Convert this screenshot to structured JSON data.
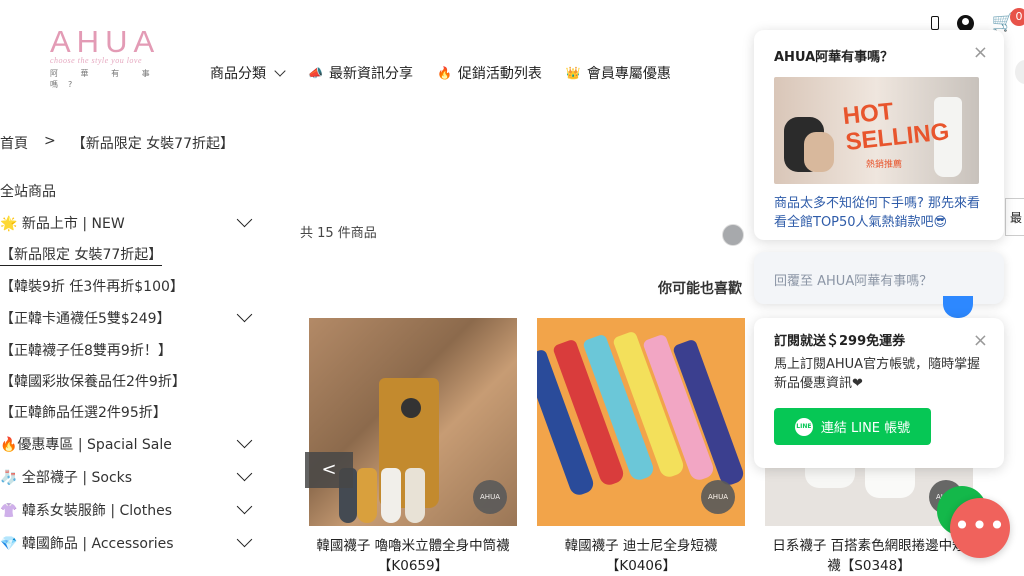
{
  "header": {
    "logo": {
      "main": "AHUA",
      "tagline": "choose the style you love",
      "zh": "阿 華 有 事 嗎?"
    },
    "nav": [
      {
        "label": "商品分類",
        "icon": "chevron-down-icon"
      },
      {
        "label": "最新資訊分享",
        "icon": "megaphone-icon"
      },
      {
        "label": "促銷活動列表",
        "icon": "fire-icon"
      },
      {
        "label": "會員專屬優惠",
        "icon": "crown-icon"
      }
    ],
    "cart_count": "0"
  },
  "breadcrumb": {
    "home": "首頁",
    "sep": ">",
    "current": "【新品限定 女裝77折起】"
  },
  "sidebar": {
    "title": "全站商品",
    "items": [
      {
        "label": "🌟 新品上市 | NEW",
        "expandable": true
      },
      {
        "label": "【新品限定 女裝77折起】",
        "expandable": false,
        "active": true
      },
      {
        "label": "【韓裝9折 任3件再折$100】",
        "expandable": false
      },
      {
        "label": "【正韓卡通襪任5雙$249】",
        "expandable": true
      },
      {
        "label": "【正韓襪子任8雙再9折！】",
        "expandable": false
      },
      {
        "label": "【韓國彩妝保養品任2件9折】",
        "expandable": false
      },
      {
        "label": "【正韓飾品任選2件95折】",
        "expandable": false
      },
      {
        "label": "🔥優惠專區 | Spacial Sale",
        "expandable": true
      },
      {
        "label": "🧦 全部襪子 | Socks",
        "expandable": true
      },
      {
        "label": "👚 韓系女裝服飾 | Clothes",
        "expandable": true
      },
      {
        "label": "💎 韓國飾品 | Accessories",
        "expandable": true
      }
    ]
  },
  "main": {
    "count_text": "共 15 件商品",
    "maybe_like": "你可能也喜歡",
    "products": [
      {
        "name": "韓國襪子 嚕嚕米立體全身中筒襪",
        "code": "【K0659】",
        "brand": "AHUA"
      },
      {
        "name": "韓國襪子 迪士尼全身短襪",
        "code": "【K0406】",
        "brand": "AHUA"
      },
      {
        "name": "日系襪子 百搭素色網眼捲邊中短",
        "code": "襪【S0348】",
        "brand": "AHUA"
      }
    ],
    "prev_label": "<"
  },
  "chat": {
    "popup1": {
      "title": "AHUA阿華有事嗎？",
      "image_text": "HOT SELLING",
      "image_subtext": "熱銷推薦",
      "desc": "商品太多不知從何下手嗎? 那先來看看全館TOP50人氣熱銷款吧😎"
    },
    "reply_placeholder": "回覆至 AHUA阿華有事嗎？",
    "popup2": {
      "title": "訂閱就送＄299免運券",
      "desc": "馬上訂閱AHUA官方帳號，隨時掌握新品優惠資訊❤",
      "button": "連結 LINE 帳號",
      "line_logo": "LINE"
    },
    "close": "×",
    "fab_dots": "•••"
  },
  "edge": {
    "label": "最"
  },
  "colors": {
    "accent_pink": "#e39bb5",
    "line_green": "#06c755",
    "cart_red": "#e8534a",
    "fab_red": "#f0625c"
  }
}
